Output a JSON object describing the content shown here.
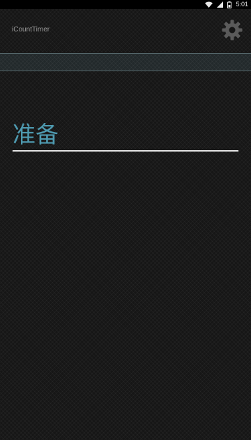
{
  "status_bar": {
    "time": "5:01",
    "icons": [
      "wifi-icon",
      "signal-icon",
      "battery-icon"
    ]
  },
  "app": {
    "title": "iCountTimer",
    "settings_icon": "gear-icon"
  },
  "main": {
    "state_label": "准备"
  },
  "colors": {
    "accent": "#4e9ab0",
    "background": "#161616",
    "band": "#22292b",
    "underline": "#e6e6e6"
  }
}
